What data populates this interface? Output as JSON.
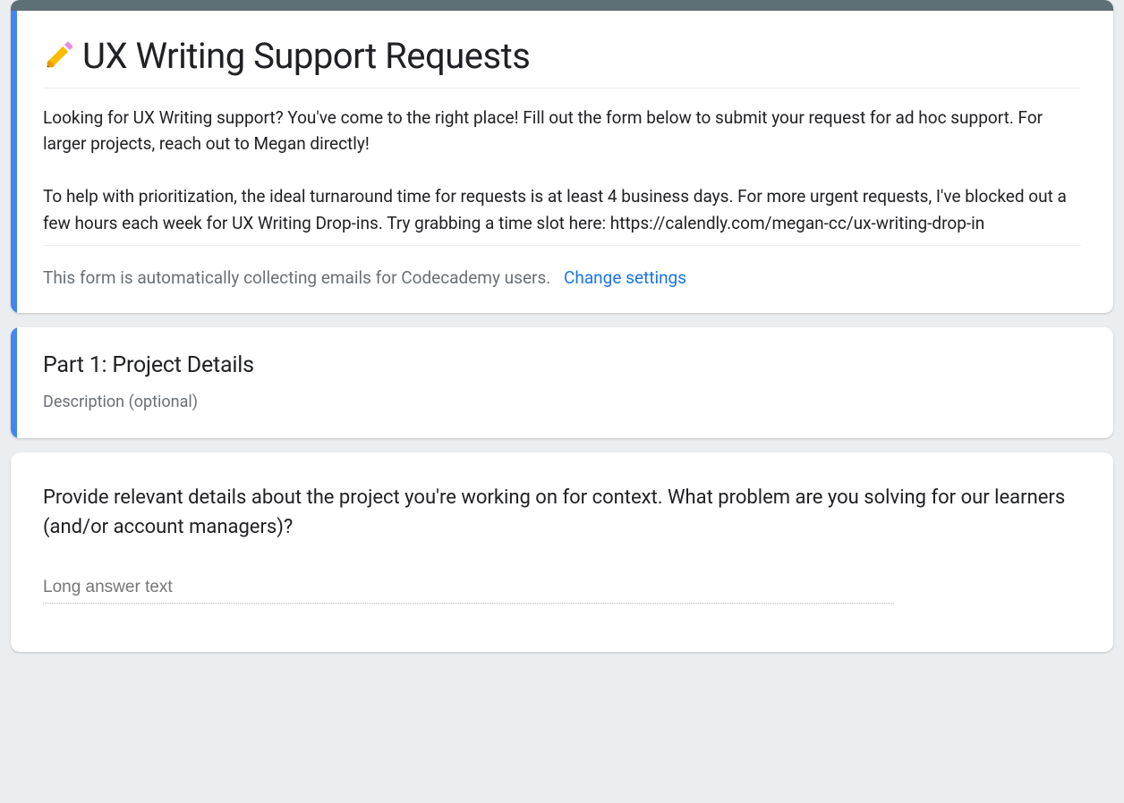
{
  "header": {
    "title_emoji_alt": "pencil-icon",
    "title": "UX Writing Support Requests",
    "description": "Looking for UX Writing support?  You've come to the right place! Fill out the form below to submit your request for ad hoc support. For larger projects, reach out to Megan directly!\n\nTo help with prioritization, the ideal turnaround time for requests is at least 4 business days. For more urgent requests, I've blocked out a few hours each week for UX Writing Drop-ins. Try grabbing a time slot here: https://calendly.com/megan-cc/ux-writing-drop-in",
    "email_notice": "This form is automatically collecting emails for Codecademy users.",
    "change_settings": "Change settings"
  },
  "section": {
    "title": "Part 1: Project Details",
    "description_placeholder": "Description (optional)"
  },
  "question": {
    "text": "Provide relevant details about the project you're working on for context. What problem are you solving for our learners (and/or account managers)?",
    "answer_placeholder": "Long answer text"
  }
}
